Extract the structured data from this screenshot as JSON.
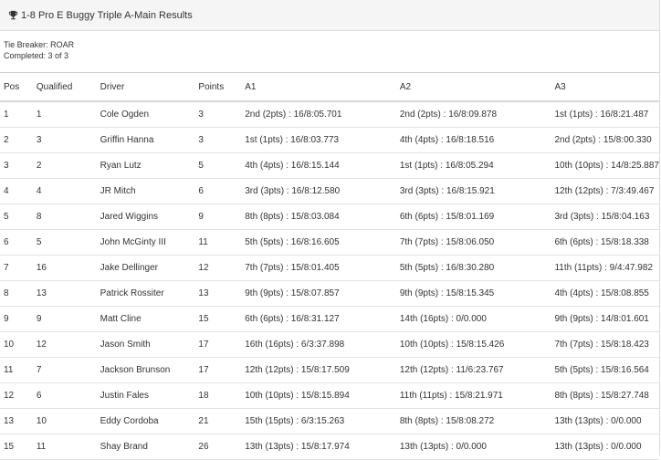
{
  "panel": {
    "title": "1-8 Pro E Buggy Triple A-Main Results",
    "tie_breaker": "Tie Breaker: ROAR",
    "completed": "Completed: 3 of 3"
  },
  "table": {
    "headers": [
      "Pos",
      "Qualified",
      "Driver",
      "Points",
      "A1",
      "A2",
      "A3"
    ],
    "rows": [
      [
        "1",
        "1",
        "Cole Ogden",
        "3",
        "2nd (2pts) : 16/8:05.701",
        "2nd (2pts) : 16/8:09.878",
        "1st (1pts) : 16/8:21.487"
      ],
      [
        "2",
        "3",
        "Griffin Hanna",
        "3",
        "1st (1pts) : 16/8:03.773",
        "4th (4pts) : 16/8:18.516",
        "2nd (2pts) : 15/8:00.330"
      ],
      [
        "3",
        "2",
        "Ryan Lutz",
        "5",
        "4th (4pts) : 16/8:15.144",
        "1st (1pts) : 16/8:05.294",
        "10th (10pts) : 14/8:25.887"
      ],
      [
        "4",
        "4",
        "JR Mitch",
        "6",
        "3rd (3pts) : 16/8:12.580",
        "3rd (3pts) : 16/8:15.921",
        "12th (12pts) : 7/3:49.467"
      ],
      [
        "5",
        "8",
        "Jared Wiggins",
        "9",
        "8th (8pts) : 15/8:03.084",
        "6th (6pts) : 15/8:01.169",
        "3rd (3pts) : 15/8:04.163"
      ],
      [
        "6",
        "5",
        "John McGinty III",
        "11",
        "5th (5pts) : 16/8:16.605",
        "7th (7pts) : 15/8:06.050",
        "6th (6pts) : 15/8:18.338"
      ],
      [
        "7",
        "16",
        "Jake Dellinger",
        "12",
        "7th (7pts) : 15/8:01.405",
        "5th (5pts) : 16/8:30.280",
        "11th (11pts) : 9/4:47.982"
      ],
      [
        "8",
        "13",
        "Patrick Rossiter",
        "13",
        "9th (9pts) : 15/8:07.857",
        "9th (9pts) : 15/8:15.345",
        "4th (4pts) : 15/8:08.855"
      ],
      [
        "9",
        "9",
        "Matt Cline",
        "15",
        "6th (6pts) : 16/8:31.127",
        "14th (16pts) : 0/0.000",
        "9th (9pts) : 14/8:01.601"
      ],
      [
        "10",
        "12",
        "Jason Smith",
        "17",
        "16th (16pts) : 6/3:37.898",
        "10th (10pts) : 15/8:15.426",
        "7th (7pts) : 15/8:18.423"
      ],
      [
        "11",
        "7",
        "Jackson Brunson",
        "17",
        "12th (12pts) : 15/8:17.509",
        "12th (12pts) : 11/6:23.767",
        "5th (5pts) : 15/8:16.564"
      ],
      [
        "12",
        "6",
        "Justin Fales",
        "18",
        "10th (10pts) : 15/8:15.894",
        "11th (11pts) : 15/8:21.971",
        "8th (8pts) : 15/8:27.748"
      ],
      [
        "13",
        "10",
        "Eddy Cordoba",
        "21",
        "15th (15pts) : 6/3:15.263",
        "8th (8pts) : 15/8:08.272",
        "13th (13pts) : 0/0.000"
      ],
      [
        "15",
        "11",
        "Shay Brand",
        "26",
        "13th (13pts) : 15/8:17.974",
        "13th (13pts) : 0/0.000",
        "13th (13pts) : 0/0.000"
      ]
    ]
  }
}
